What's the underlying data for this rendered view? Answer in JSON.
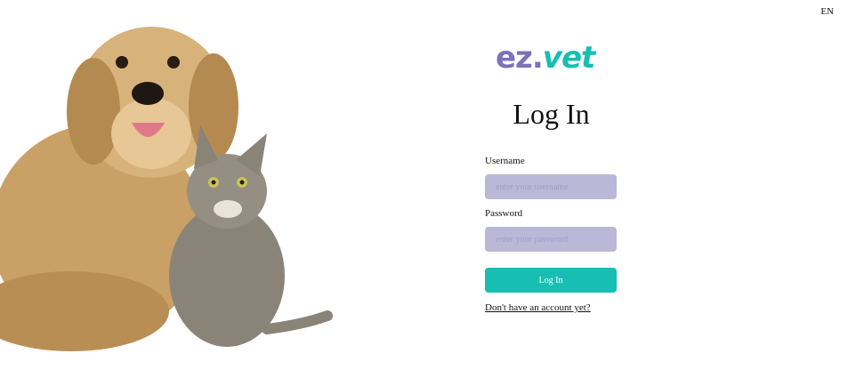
{
  "header": {
    "language": "EN"
  },
  "brand": {
    "part1": "ez",
    "dot": ".",
    "part2": "vet",
    "color_primary": "#7b72b8",
    "color_accent": "#16bfb1"
  },
  "form": {
    "title": "Log In",
    "username_label": "Username",
    "username_placeholder": "enter your username",
    "password_label": "Password",
    "password_placeholder": "enter your password",
    "submit_label": "Log In",
    "signup_link": "Don't have an account yet?"
  },
  "hero": {
    "subject": "golden retriever and tabby cat"
  }
}
